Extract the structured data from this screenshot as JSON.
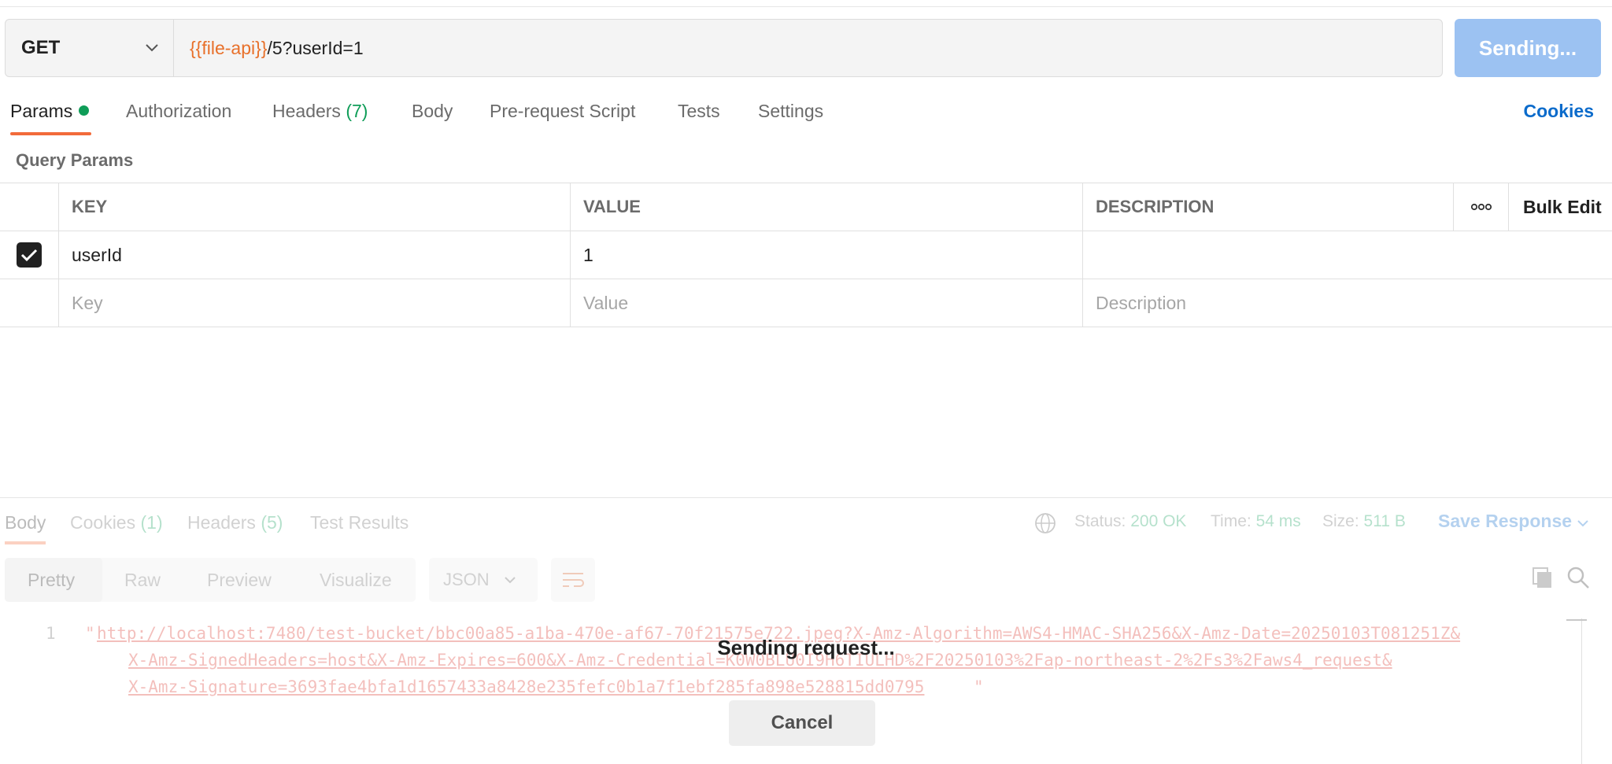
{
  "request": {
    "method": "GET",
    "url_var": "{{file-api}}",
    "url_rest": "/5?userId=1",
    "send_label": "Sending..."
  },
  "tabs": {
    "params": "Params",
    "authorization": "Authorization",
    "headers": "Headers",
    "headers_count": "(7)",
    "body": "Body",
    "prerequest": "Pre-request Script",
    "tests": "Tests",
    "settings": "Settings",
    "cookies": "Cookies"
  },
  "query_params": {
    "title": "Query Params",
    "headers": {
      "key": "KEY",
      "value": "VALUE",
      "description": "DESCRIPTION",
      "bulk_edit": "Bulk Edit"
    },
    "rows": [
      {
        "key": "userId",
        "value": "1",
        "description": ""
      }
    ],
    "placeholders": {
      "key": "Key",
      "value": "Value",
      "description": "Description"
    }
  },
  "response": {
    "tabs": {
      "body": "Body",
      "cookies": "Cookies",
      "cookies_count": "(1)",
      "headers": "Headers",
      "headers_count": "(5)",
      "test_results": "Test Results"
    },
    "status_label": "Status:",
    "status_value": "200 OK",
    "time_label": "Time:",
    "time_value": "54 ms",
    "size_label": "Size:",
    "size_value": "511 B",
    "save_response": "Save Response",
    "views": {
      "pretty": "Pretty",
      "raw": "Raw",
      "preview": "Preview",
      "visualize": "Visualize"
    },
    "format": "JSON",
    "line_number": "1",
    "code_lines": [
      "http://localhost:7480/test-bucket/bbc00a85-a1ba-470e-af67-70f21575e722.jpeg?X-Amz-Algorithm=AWS4-HMAC-SHA256&X-Amz-Date=20250103T081251Z&",
      "X-Amz-SignedHeaders=host&X-Amz-Expires=600&X-Amz-Credential=K0W0BLU0I9H6TIULHD%2F20250103%2Fap-northeast-2%2Fs3%2Faws4_request&",
      "X-Amz-Signature=3693fae4bfa1d1657433a8428e235fefc0b1a7f1ebf285fa898e528815dd0795"
    ]
  },
  "overlay": {
    "message": "Sending request...",
    "cancel": "Cancel"
  }
}
